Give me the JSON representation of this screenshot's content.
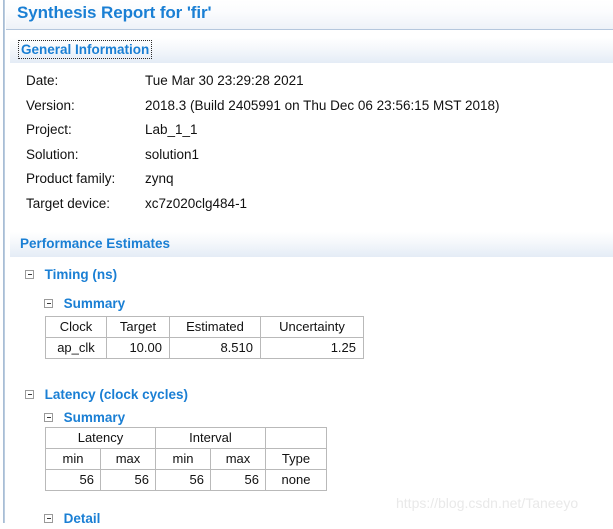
{
  "window": {
    "title": "Synthesis Report for 'fir'"
  },
  "sections": {
    "general": {
      "header": "General Information",
      "rows": [
        {
          "label": "Date:",
          "value": "Tue Mar 30 23:29:28 2021"
        },
        {
          "label": "Version:",
          "value": "2018.3 (Build 2405991 on Thu Dec 06 23:56:15 MST 2018)"
        },
        {
          "label": "Project:",
          "value": "Lab_1_1"
        },
        {
          "label": "Solution:",
          "value": "solution1"
        },
        {
          "label": "Product family:",
          "value": "zynq"
        },
        {
          "label": "Target device:",
          "value": "xc7z020clg484-1"
        }
      ]
    },
    "performance": {
      "header": "Performance Estimates",
      "timing": {
        "node_label": "Timing (ns)",
        "summary_label": "Summary",
        "table": {
          "headers": [
            "Clock",
            "Target",
            "Estimated",
            "Uncertainty"
          ],
          "rows": [
            {
              "clock": "ap_clk",
              "target": "10.00",
              "estimated": "8.510",
              "uncertainty": "1.25"
            }
          ]
        }
      },
      "latency": {
        "node_label": "Latency (clock cycles)",
        "summary_label": "Summary",
        "detail_label": "Detail",
        "table": {
          "group_headers": [
            "Latency",
            "Interval",
            ""
          ],
          "sub_headers": [
            "min",
            "max",
            "min",
            "max",
            "Type"
          ],
          "rows": [
            {
              "latency_min": "56",
              "latency_max": "56",
              "interval_min": "56",
              "interval_max": "56",
              "type": "none"
            }
          ]
        }
      }
    }
  },
  "watermark": {
    "text": "https://blog.csdn.net/Taneeyo"
  },
  "colors": {
    "accent_blue": "#1a7fd4",
    "band_gradient_end": "#e4ecf6",
    "table_border": "#b9b9b9",
    "watermark": "#e9e9e9"
  },
  "icons": {
    "expander": "minus-square-icon"
  }
}
